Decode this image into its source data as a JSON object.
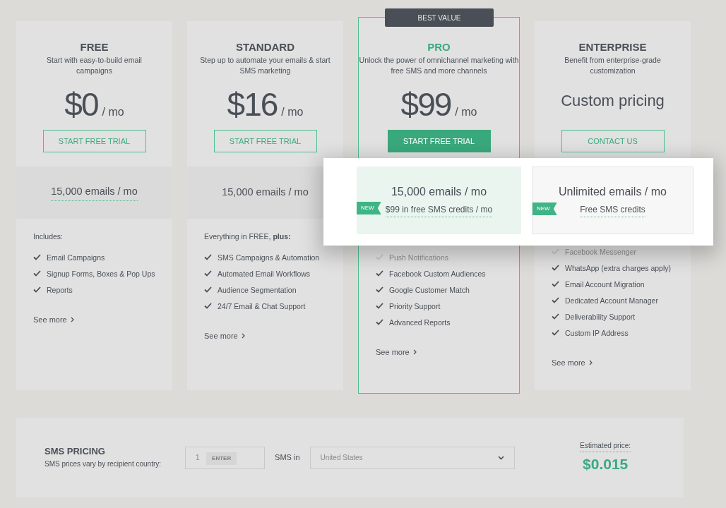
{
  "plans": [
    {
      "name": "FREE",
      "selected": false,
      "description": "Start with easy-to-build email campaigns",
      "price": "$0",
      "period": "/ mo",
      "button": {
        "label": "START FREE TRIAL",
        "kind": "outline"
      },
      "band": {
        "headline": "15,000 emails / mo",
        "underlined": true,
        "highlight": false
      },
      "list_heading": "Includes:",
      "features": [
        {
          "text": "Email Campaigns",
          "faded": false
        },
        {
          "text": "Signup Forms, Boxes & Pop Ups",
          "faded": false
        },
        {
          "text": "Reports",
          "faded": false
        }
      ],
      "see_more": "See more"
    },
    {
      "name": "STANDARD",
      "selected": false,
      "description": "Step up to automate your emails & start SMS marketing",
      "price": "$16",
      "period": "/ mo",
      "button": {
        "label": "START FREE TRIAL",
        "kind": "outline"
      },
      "band": {
        "headline": "15,000 emails / mo",
        "underlined": false,
        "highlight": false
      },
      "list_heading": "Everything in FREE, **plus:**",
      "features": [
        {
          "text": "SMS Campaigns & Automation",
          "faded": false
        },
        {
          "text": "Automated Email Workflows",
          "faded": false
        },
        {
          "text": "Audience Segmentation",
          "faded": false
        },
        {
          "text": "24/7 Email & Chat Support",
          "faded": false
        }
      ],
      "see_more": "See more"
    },
    {
      "name": "PRO",
      "selected": true,
      "badge": "BEST VALUE",
      "description": "Unlock the power of omnichannel marketing with free SMS and more channels",
      "price": "$99",
      "period": "/ mo",
      "button": {
        "label": "START FREE TRIAL",
        "kind": "filled"
      },
      "band": {
        "headline": "15,000 emails / mo",
        "underlined": false,
        "highlight": true,
        "tag": "NEW",
        "sub": "$99 in free SMS credits / mo"
      },
      "features": [
        {
          "text": "Push Notifications",
          "faded": true
        },
        {
          "text": "Facebook Custom Audiences",
          "faded": false
        },
        {
          "text": "Google Customer Match",
          "faded": false
        },
        {
          "text": "Priority Support",
          "faded": false
        },
        {
          "text": "Advanced Reports",
          "faded": false
        }
      ],
      "see_more": "See more"
    },
    {
      "name": "ENTERPRISE",
      "selected": false,
      "description": "Benefit from enterprise-grade customization",
      "price": "Custom pricing",
      "button": {
        "label": "CONTACT US",
        "kind": "outline"
      },
      "band": {
        "headline": "Unlimited emails / mo",
        "underlined": false,
        "highlight": true,
        "tag": "NEW",
        "sub": "Free SMS credits"
      },
      "features": [
        {
          "text": "Facebook Messenger",
          "faded": true
        },
        {
          "text": "WhatsApp (extra charges apply)",
          "faded": false
        },
        {
          "text": "Email Account Migration",
          "faded": false
        },
        {
          "text": "Dedicated Account Manager",
          "faded": false
        },
        {
          "text": "Deliverability Support",
          "faded": false
        },
        {
          "text": "Custom IP Address",
          "faded": false
        }
      ],
      "see_more": "See more"
    }
  ],
  "sms_pricing": {
    "title": "SMS PRICING",
    "subtitle": "SMS prices vary by recipient country:",
    "quantity": "1",
    "enter_label": "ENTER",
    "country_label": "SMS in",
    "country_placeholder": "United States",
    "estimate_label": "Estimated price:",
    "estimate": "$0.015"
  }
}
